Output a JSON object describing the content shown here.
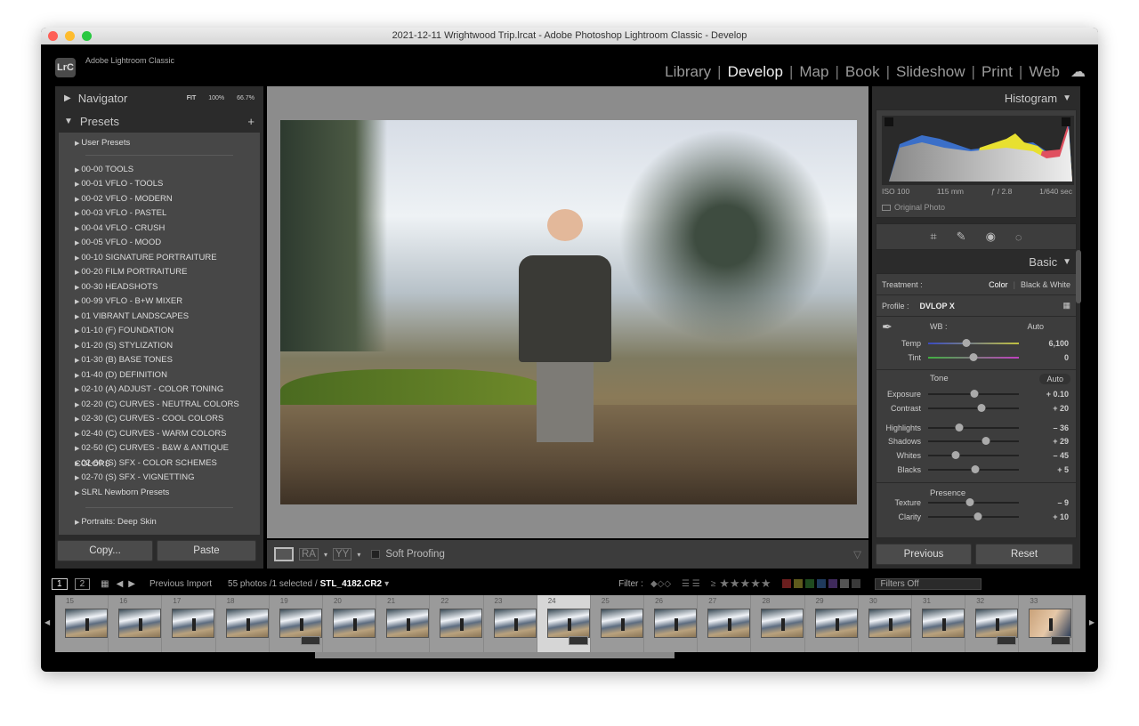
{
  "window": {
    "title": "2021-12-11 Wrightwood Trip.lrcat - Adobe Photoshop Lightroom Classic - Develop"
  },
  "app": {
    "logo": "LrC",
    "name": "Adobe Lightroom Classic"
  },
  "modules": [
    "Library",
    "Develop",
    "Map",
    "Book",
    "Slideshow",
    "Print",
    "Web"
  ],
  "active_module": "Develop",
  "navigator": {
    "title": "Navigator",
    "fit": "FIT",
    "z1": "100%",
    "z2": "66.7%"
  },
  "presets": {
    "title": "Presets",
    "add": "+",
    "user": "User Presets",
    "items": [
      "00-00 TOOLS",
      "00-01 VFLO - TOOLS",
      "00-02 VFLO - MODERN",
      "00-03 VFLO - PASTEL",
      "00-04 VFLO - CRUSH",
      "00-05 VFLO - MOOD",
      "00-10 SIGNATURE PORTRAITURE",
      "00-20 FILM PORTRAITURE",
      "00-30 HEADSHOTS",
      "00-99 VFLO - B+W MIXER",
      "01 VIBRANT LANDSCAPES",
      "01-10 (F) FOUNDATION",
      "01-20 (S) STYLIZATION",
      "01-30 (B) BASE TONES",
      "01-40 (D) DEFINITION",
      "02-10 (A) ADJUST - COLOR TONING",
      "02-20 (C) CURVES - NEUTRAL COLORS",
      "02-30 (C) CURVES - COOL COLORS",
      "02-40 (C) CURVES - WARM COLORS",
      "02-50 (C) CURVES - B&W & ANTIQUE COLORS",
      "02-60 (S) SFX - COLOR SCHEMES",
      "02-70 (S) SFX - VIGNETTING",
      "SLRL Newborn Presets"
    ],
    "last": "Portraits: Deep Skin"
  },
  "left_buttons": {
    "copy": "Copy...",
    "paste": "Paste"
  },
  "toolbar": {
    "soft_proofing": "Soft Proofing",
    "ra": "RA",
    "yy": "YY"
  },
  "histogram": {
    "title": "Histogram",
    "iso": "ISO 100",
    "focal": "115 mm",
    "aperture": "ƒ / 2.8",
    "shutter": "1/640 sec",
    "original_photo": "Original Photo"
  },
  "basic": {
    "title": "Basic",
    "treatment_label": "Treatment :",
    "color": "Color",
    "bw": "Black & White",
    "profile_label": "Profile :",
    "profile": "DVLOP X",
    "wb_label": "WB :",
    "wb": "Auto",
    "tone": "Tone",
    "auto": "Auto",
    "presence": "Presence",
    "wbsliders": [
      {
        "label": "Temp",
        "value": "6,100",
        "pos": 0.42
      },
      {
        "label": "Tint",
        "value": "0",
        "pos": 0.5
      }
    ],
    "tonesliders": [
      {
        "label": "Exposure",
        "value": "+ 0.10",
        "pos": 0.51
      },
      {
        "label": "Contrast",
        "value": "+ 20",
        "pos": 0.59
      }
    ],
    "tonesliders2": [
      {
        "label": "Highlights",
        "value": "– 36",
        "pos": 0.34
      },
      {
        "label": "Shadows",
        "value": "+ 29",
        "pos": 0.64
      },
      {
        "label": "Whites",
        "value": "– 45",
        "pos": 0.3
      },
      {
        "label": "Blacks",
        "value": "+ 5",
        "pos": 0.52
      }
    ],
    "presencesliders": [
      {
        "label": "Texture",
        "value": "– 9",
        "pos": 0.46
      },
      {
        "label": "Clarity",
        "value": "+ 10",
        "pos": 0.55
      }
    ]
  },
  "right_buttons": {
    "previous": "Previous",
    "reset": "Reset"
  },
  "filmstrip": {
    "view1": "1",
    "view2": "2",
    "source": "Previous Import",
    "count": "55 photos /1 selected /",
    "file": "STL_4182.CR2",
    "filter_label": "Filter :",
    "ge": "≥",
    "filters_off": "Filters Off",
    "frames": [
      {
        "n": "15"
      },
      {
        "n": "16"
      },
      {
        "n": "17"
      },
      {
        "n": "18"
      },
      {
        "n": "19",
        "badge": true
      },
      {
        "n": "20"
      },
      {
        "n": "21"
      },
      {
        "n": "22"
      },
      {
        "n": "23"
      },
      {
        "n": "24",
        "badge": true,
        "selected": true
      },
      {
        "n": "25"
      },
      {
        "n": "26"
      },
      {
        "n": "27"
      },
      {
        "n": "28"
      },
      {
        "n": "29"
      },
      {
        "n": "30"
      },
      {
        "n": "31"
      },
      {
        "n": "32",
        "badge": true
      },
      {
        "n": "33",
        "badge": true
      }
    ],
    "color_labels": [
      "#6b1e1e",
      "#5e5a1c",
      "#1f4a1f",
      "#1f3a5c",
      "#3f2a5c",
      "#555555",
      "#3a3a3a"
    ]
  }
}
